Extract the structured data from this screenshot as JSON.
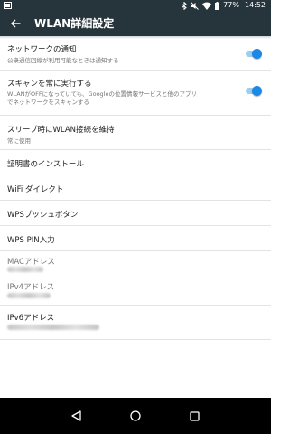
{
  "status_bar": {
    "battery": "77%",
    "time": "14:52",
    "icons": [
      "screenshot-icon",
      "bluetooth-icon",
      "mute-icon",
      "wifi-icon",
      "battery-icon"
    ]
  },
  "app_bar": {
    "title": "WLAN詳細設定",
    "back_icon": "arrow-back-icon"
  },
  "settings": {
    "network_notification": {
      "title": "ネットワークの通知",
      "summary": "公衆通信回線が利用可能なときは通知する",
      "enabled": true
    },
    "always_scan": {
      "title": "スキャンを常に実行する",
      "summary_line1": "WLANがOFFになっていても、Googleの位置情報サービスと他のアプリ",
      "summary_line2": "でネットワークをスキャンする",
      "enabled": true
    },
    "keep_wifi_sleep": {
      "title": "スリープ時にWLAN接続を維持",
      "summary": "常に使用"
    },
    "install_certs": {
      "title": "証明書のインストール"
    },
    "wifi_direct": {
      "title": "WiFi ダイレクト"
    },
    "wps_push": {
      "title": "WPSプッシュボタン"
    },
    "wps_pin": {
      "title": "WPS PIN入力"
    },
    "mac_address": {
      "title": "MACアドレス"
    },
    "ipv4_address": {
      "title": "IPv4アドレス"
    },
    "ipv6_address": {
      "title": "IPv6アドレス"
    }
  },
  "colors": {
    "app_bar": "#26343c",
    "accent": "#1e88e5",
    "toggle_track": "#9ad0ee",
    "nav_bar": "#000000"
  },
  "nav_bar": {
    "icons": [
      "back-triangle-icon",
      "home-circle-icon",
      "recents-square-icon"
    ]
  }
}
